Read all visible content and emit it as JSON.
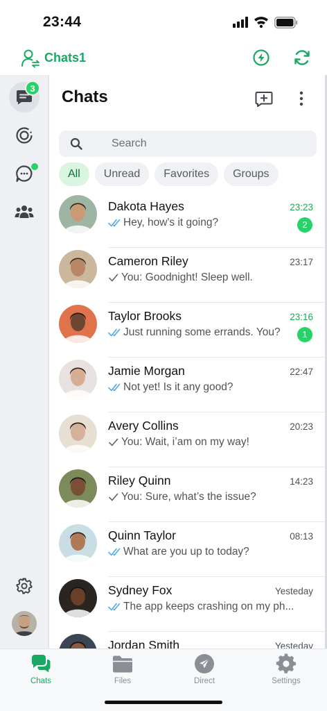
{
  "status_bar": {
    "time": "23:44"
  },
  "header": {
    "app_name": "Chats1"
  },
  "rail": {
    "unread_count": "3"
  },
  "main": {
    "title": "Chats",
    "search": {
      "placeholder": "Search"
    },
    "filters": [
      "All",
      "Unread",
      "Favorites",
      "Groups"
    ],
    "active_filter": "All"
  },
  "chats": [
    {
      "name": "Dakota Hayes",
      "time": "23:23",
      "preview": "Hey, how's it going?",
      "tick": "double",
      "unread": "2",
      "avatar_bg": "#9fb5a4",
      "skin": "#c99a76",
      "hair": "#2c2218"
    },
    {
      "name": "Cameron Riley",
      "time": "23:17",
      "preview": "You: Goodnight! Sleep well.",
      "tick": "single",
      "unread": "",
      "avatar_bg": "#cbb79c",
      "skin": "#b98665",
      "hair": "#3a2a1c"
    },
    {
      "name": "Taylor Brooks",
      "time": "23:16",
      "preview": "Just running some errands. You?",
      "tick": "double",
      "unread": "1",
      "avatar_bg": "#e0734b",
      "skin": "#6e4531",
      "hair": "#1f1712"
    },
    {
      "name": "Jamie Morgan",
      "time": "22:47",
      "preview": "Not yet! Is it any good?",
      "tick": "double",
      "unread": "",
      "avatar_bg": "#e7e2df",
      "skin": "#d7ad93",
      "hair": "#2b1e19"
    },
    {
      "name": "Avery Collins",
      "time": "20:23",
      "preview": "You: Wait, i’am on my way!",
      "tick": "single",
      "unread": "",
      "avatar_bg": "#e7dfd2",
      "skin": "#d4b199",
      "hair": "#1e1714"
    },
    {
      "name": "Riley Quinn",
      "time": "14:23",
      "preview": "You: Sure, what’s the issue?",
      "tick": "single",
      "unread": "",
      "avatar_bg": "#7d8b5a",
      "skin": "#7a4f35",
      "hair": "#1a1411"
    },
    {
      "name": "Quinn Taylor",
      "time": "08:13",
      "preview": "What are you up to today?",
      "tick": "double",
      "unread": "",
      "avatar_bg": "#c9dde5",
      "skin": "#b07a59",
      "hair": "#2c1d14"
    },
    {
      "name": "Sydney Fox",
      "time": "Yesteday",
      "preview": "The app keeps crashing on my ph...",
      "tick": "double",
      "unread": "",
      "avatar_bg": "#2b2522",
      "skin": "#6a3f2a",
      "hair": "#141010"
    },
    {
      "name": "Jordan Smith",
      "time": "Yesteday",
      "preview": "",
      "tick": "",
      "unread": "",
      "avatar_bg": "#3c4552",
      "skin": "#8a5a3f",
      "hair": "#141010"
    }
  ],
  "tabs": [
    {
      "label": "Chats",
      "icon": "chats-icon",
      "active": true
    },
    {
      "label": "Files",
      "icon": "folder-icon",
      "active": false
    },
    {
      "label": "Direct",
      "icon": "send-icon",
      "active": false
    },
    {
      "label": "Settings",
      "icon": "gear-icon",
      "active": false
    }
  ],
  "colors": {
    "accent": "#1aa865",
    "badge": "#25d366",
    "read_tick": "#4fa7e6"
  }
}
